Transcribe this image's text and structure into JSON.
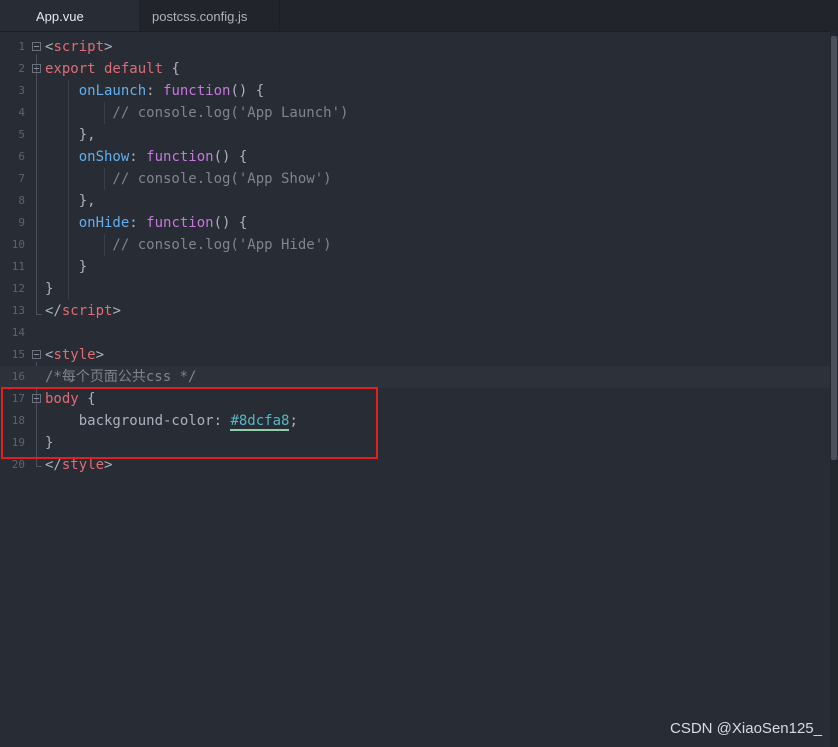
{
  "tabs": [
    {
      "label": "App.vue",
      "active": true
    },
    {
      "label": "postcss.config.js",
      "active": false
    }
  ],
  "lines": [
    {
      "n": "1",
      "tokens": [
        {
          "t": "<",
          "c": ""
        },
        {
          "t": "script",
          "c": "t-tag"
        },
        {
          "t": ">",
          "c": ""
        }
      ]
    },
    {
      "n": "2",
      "tokens": [
        {
          "t": "export default",
          "c": "t-tag"
        },
        {
          "t": " {",
          "c": ""
        }
      ]
    },
    {
      "n": "3",
      "tokens": [
        {
          "t": "    ",
          "c": ""
        },
        {
          "t": "onLaunch",
          "c": "t-fn"
        },
        {
          "t": ": ",
          "c": ""
        },
        {
          "t": "function",
          "c": "t-kw"
        },
        {
          "t": "() {",
          "c": ""
        }
      ]
    },
    {
      "n": "4",
      "tokens": [
        {
          "t": "        // console.log('App Launch')",
          "c": "t-cm"
        }
      ]
    },
    {
      "n": "5",
      "tokens": [
        {
          "t": "    },",
          "c": ""
        }
      ]
    },
    {
      "n": "6",
      "tokens": [
        {
          "t": "    ",
          "c": ""
        },
        {
          "t": "onShow",
          "c": "t-fn"
        },
        {
          "t": ": ",
          "c": ""
        },
        {
          "t": "function",
          "c": "t-kw"
        },
        {
          "t": "() {",
          "c": ""
        }
      ]
    },
    {
      "n": "7",
      "tokens": [
        {
          "t": "        // console.log('App Show')",
          "c": "t-cm"
        }
      ]
    },
    {
      "n": "8",
      "tokens": [
        {
          "t": "    },",
          "c": ""
        }
      ]
    },
    {
      "n": "9",
      "tokens": [
        {
          "t": "    ",
          "c": ""
        },
        {
          "t": "onHide",
          "c": "t-fn"
        },
        {
          "t": ": ",
          "c": ""
        },
        {
          "t": "function",
          "c": "t-kw"
        },
        {
          "t": "() {",
          "c": ""
        }
      ]
    },
    {
      "n": "10",
      "tokens": [
        {
          "t": "        // console.log('App Hide')",
          "c": "t-cm"
        }
      ]
    },
    {
      "n": "11",
      "tokens": [
        {
          "t": "    }",
          "c": ""
        }
      ]
    },
    {
      "n": "12",
      "tokens": [
        {
          "t": "}",
          "c": ""
        }
      ]
    },
    {
      "n": "13",
      "tokens": [
        {
          "t": "</",
          "c": ""
        },
        {
          "t": "script",
          "c": "t-tag"
        },
        {
          "t": ">",
          "c": ""
        }
      ]
    },
    {
      "n": "14",
      "tokens": []
    },
    {
      "n": "15",
      "tokens": [
        {
          "t": "<",
          "c": ""
        },
        {
          "t": "style",
          "c": "t-tag"
        },
        {
          "t": ">",
          "c": ""
        }
      ]
    },
    {
      "n": "16",
      "tokens": [
        {
          "t": "/*每个页面公共css */",
          "c": "t-cm"
        }
      ]
    },
    {
      "n": "17",
      "tokens": [
        {
          "t": "body",
          "c": "t-sel"
        },
        {
          "t": " {",
          "c": ""
        }
      ]
    },
    {
      "n": "18",
      "tokens": [
        {
          "t": "    background-color: ",
          "c": "t-prop"
        },
        {
          "t": "#8dcfa8",
          "c": "t-col"
        },
        {
          "t": ";",
          "c": ""
        }
      ]
    },
    {
      "n": "19",
      "tokens": [
        {
          "t": "}",
          "c": ""
        }
      ]
    },
    {
      "n": "20",
      "tokens": [
        {
          "t": "</",
          "c": ""
        },
        {
          "t": "style",
          "c": "t-tag"
        },
        {
          "t": ">",
          "c": ""
        }
      ]
    }
  ],
  "folds": [
    "1",
    "2",
    "15",
    "17"
  ],
  "current_line": "16",
  "watermark": "CSDN @XiaoSen125_",
  "colors": {
    "background": "#282c34",
    "tag": "#e06c75",
    "keyword": "#c678dd",
    "function": "#61afef",
    "comment": "#7f848e",
    "highlight_box": "#e02020"
  }
}
